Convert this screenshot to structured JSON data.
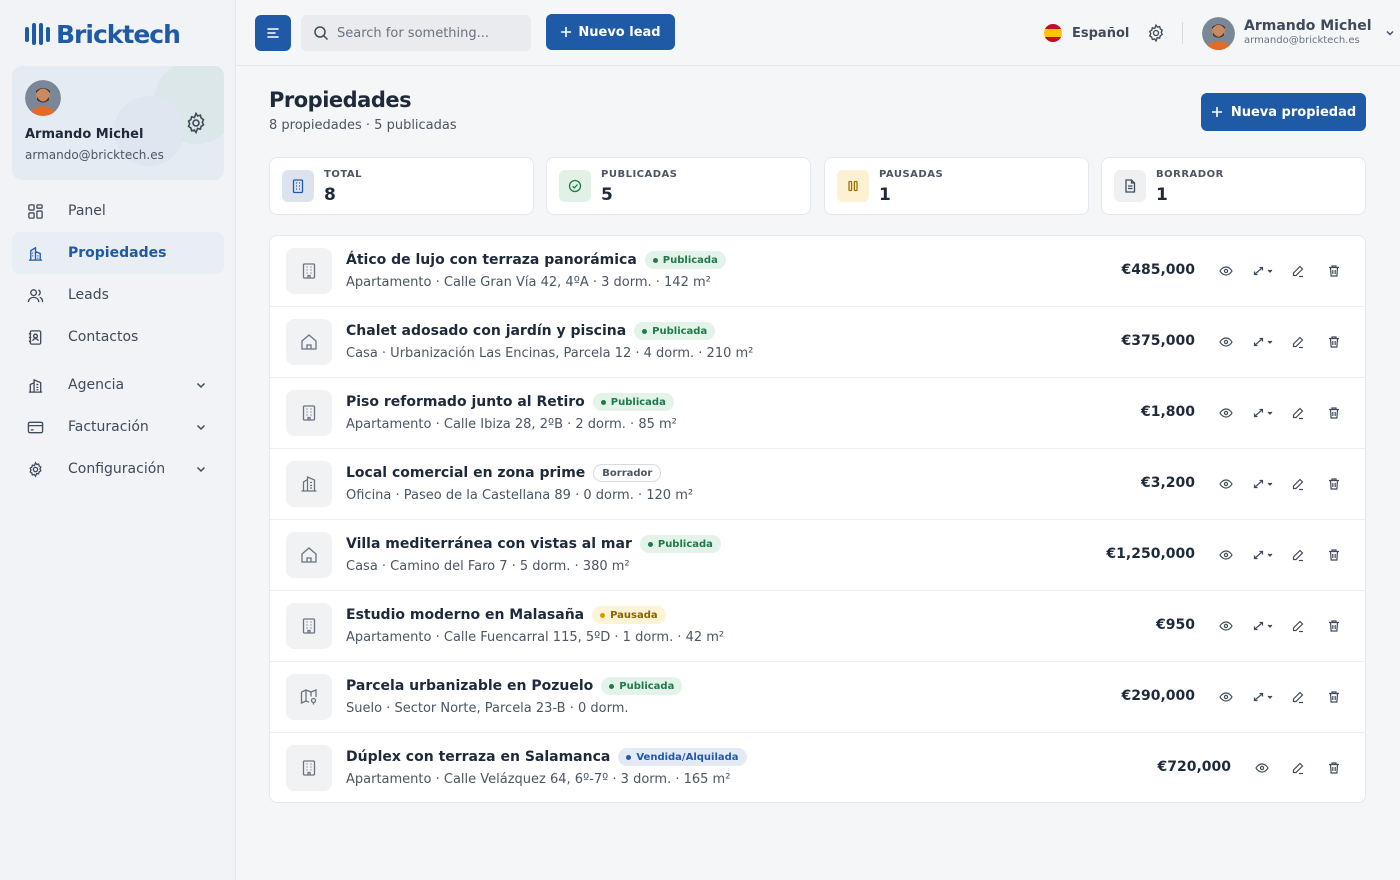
{
  "brand": {
    "name": "Bricktech",
    "accent": "#1f5aa6"
  },
  "sidebar": {
    "profile": {
      "name": "Armando Michel",
      "email": "armando@bricktech.es"
    },
    "items": [
      {
        "label": "Panel",
        "icon": "dashboard-icon",
        "active": false
      },
      {
        "label": "Propiedades",
        "icon": "building-icon",
        "active": true
      },
      {
        "label": "Leads",
        "icon": "users-icon",
        "active": false
      },
      {
        "label": "Contactos",
        "icon": "contacts-icon",
        "active": false
      },
      {
        "label": "Agencia",
        "icon": "agency-icon",
        "expandable": true
      },
      {
        "label": "Facturación",
        "icon": "billing-icon",
        "expandable": true
      },
      {
        "label": "Configuración",
        "icon": "gear-icon",
        "expandable": true
      }
    ]
  },
  "topbar": {
    "search_placeholder": "Search for something...",
    "new_lead_label": "Nuevo lead",
    "language": "Español",
    "user": {
      "name": "Armando Michel",
      "email": "armando@bricktech.es"
    }
  },
  "main": {
    "title": "Propiedades",
    "subtitle": "8 propiedades · 5 publicadas",
    "new_property_label": "Nueva propiedad",
    "stats": [
      {
        "label": "TOTAL",
        "value": "8",
        "icon": "building-icon"
      },
      {
        "label": "PUBLICADAS",
        "value": "5",
        "icon": "check-circle-icon"
      },
      {
        "label": "PAUSADAS",
        "value": "1",
        "icon": "pause-icon"
      },
      {
        "label": "BORRADOR",
        "value": "1",
        "icon": "document-icon"
      }
    ],
    "properties": [
      {
        "title": "Ático de lujo con terraza panorámica",
        "status": "Publicada",
        "status_type": "pub",
        "details": "Apartamento · Calle Gran Vía 42, 4ºA · 3 dorm. · 142 m²",
        "price": "€485,000",
        "icon": "apartment-icon"
      },
      {
        "title": "Chalet adosado con jardín y piscina",
        "status": "Publicada",
        "status_type": "pub",
        "details": "Casa · Urbanización Las Encinas, Parcela 12 · 4 dorm. · 210 m²",
        "price": "€375,000",
        "icon": "house-icon"
      },
      {
        "title": "Piso reformado junto al Retiro",
        "status": "Publicada",
        "status_type": "pub",
        "details": "Apartamento · Calle Ibiza 28, 2ºB · 2 dorm. · 85 m²",
        "price": "€1,800",
        "icon": "apartment-icon"
      },
      {
        "title": "Local comercial en zona prime",
        "status": "Borrador",
        "status_type": "draft",
        "details": "Oficina · Paseo de la Castellana 89 · 0 dorm. · 120 m²",
        "price": "€3,200",
        "icon": "office-icon"
      },
      {
        "title": "Villa mediterránea con vistas al mar",
        "status": "Publicada",
        "status_type": "pub",
        "details": "Casa · Camino del Faro 7 · 5 dorm. · 380 m²",
        "price": "€1,250,000",
        "icon": "house-icon"
      },
      {
        "title": "Estudio moderno en Malasaña",
        "status": "Pausada",
        "status_type": "paused",
        "details": "Apartamento · Calle Fuencarral 115, 5ºD · 1 dorm. · 42 m²",
        "price": "€950",
        "icon": "apartment-icon"
      },
      {
        "title": "Parcela urbanizable en Pozuelo",
        "status": "Publicada",
        "status_type": "pub",
        "details": "Suelo · Sector Norte, Parcela 23-B · 0 dorm.",
        "price": "€290,000",
        "icon": "map-icon"
      },
      {
        "title": "Dúplex con terraza en Salamanca",
        "status": "Vendida/Alquilada",
        "status_type": "sold",
        "details": "Apartamento · Calle Velázquez 64, 6º-7º · 3 dorm. · 165 m²",
        "price": "€720,000",
        "icon": "apartment-icon"
      }
    ]
  }
}
